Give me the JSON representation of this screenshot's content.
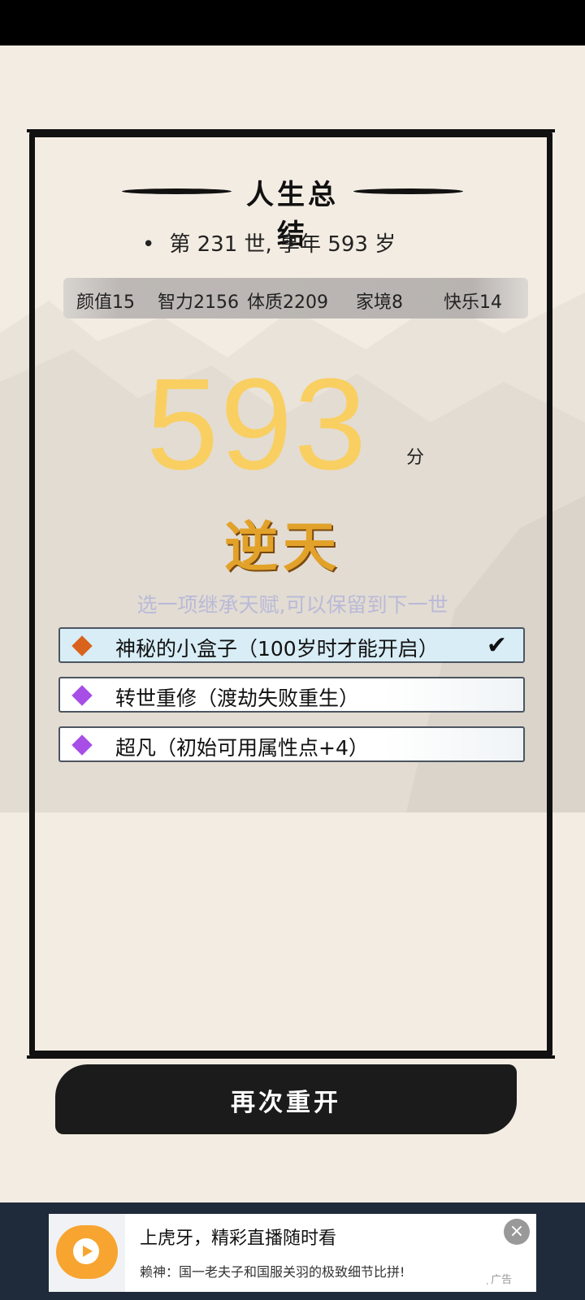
{
  "summary": {
    "title": "人生总结",
    "life_line": "第 231 世, 享年 593 岁",
    "attributes": [
      {
        "label": "颜值15"
      },
      {
        "label": "智力2156"
      },
      {
        "label": "体质2209"
      },
      {
        "label": "家境8"
      },
      {
        "label": "快乐14"
      }
    ],
    "score": "593",
    "score_unit": "分",
    "grade": "逆天"
  },
  "inherit": {
    "hint": "选一项继承天赋,可以保留到下一世",
    "talents": [
      {
        "label": "神秘的小盒子（100岁时才能开启）",
        "color": "#d9631c",
        "selected": true,
        "check": "✔"
      },
      {
        "label": "转世重修（渡劫失败重生）",
        "color": "#a64ee6",
        "selected": false
      },
      {
        "label": "超凡（初始可用属性点+4）",
        "color": "#a64ee6",
        "selected": false
      }
    ]
  },
  "restart_button": {
    "label": "再次重开"
  },
  "ad": {
    "title": "上虎牙，精彩直播随时看",
    "description": "赖神：国一老夫子和国服关羽的极致细节比拼!",
    "tag": "广告",
    "close_icon": "close-icon"
  },
  "colors": {
    "background": "#f3ece2",
    "score": "#f9cf62",
    "grade": "#e2a22a",
    "hint": "#b9bad8"
  }
}
